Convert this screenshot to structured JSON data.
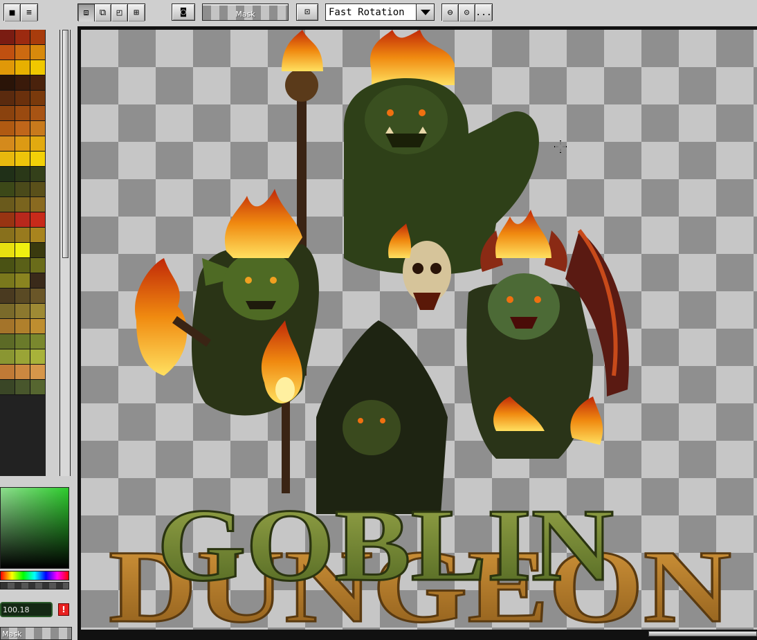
{
  "toolbar": {
    "mask_label": "Mask",
    "mode_value": "Fast Rotation",
    "more_label": "...",
    "buttons": [
      "stop-icon",
      "menu-icon",
      "select-icon",
      "copy-icon",
      "paste-icon",
      "grid-icon",
      "brush-icon",
      "sieve-icon"
    ]
  },
  "sidebar": {
    "zoom_value": "100.18",
    "warning_label": "!",
    "mask_label": "Mask",
    "palette": [
      "#7a1c12",
      "#9c2a10",
      "#a83c0c",
      "#c05010",
      "#cc6a10",
      "#d88a0c",
      "#e09808",
      "#e8b000",
      "#f0c800",
      "#2a1408",
      "#3a1a0a",
      "#4a220c",
      "#5a2a0e",
      "#6a300c",
      "#7a3a0c",
      "#8a420e",
      "#9a4a10",
      "#a85414",
      "#b05a12",
      "#c0661a",
      "#c87a1c",
      "#d48a1c",
      "#dc9a14",
      "#e2aa10",
      "#e8b80e",
      "#eec40a",
      "#f2d008",
      "#203018",
      "#2a3818",
      "#34401a",
      "#3c4818",
      "#4a4a1a",
      "#5a501a",
      "#6a5a1c",
      "#7a641e",
      "#8a6a20",
      "#983412",
      "#b8281c",
      "#c82a1a",
      "#88701c",
      "#987a1e",
      "#a8841e",
      "#e8e010",
      "#f0f010",
      "#3a3a0e",
      "#4a5214",
      "#5a6018",
      "#6a6c1a",
      "#7a781c",
      "#8a8420",
      "#3a2a1a",
      "#4a3a20",
      "#5a4a24",
      "#6a5628",
      "#7a6a2a",
      "#8c782e",
      "#9e8a34",
      "#a4742a",
      "#b0802c",
      "#be8e30",
      "#5c6a26",
      "#6a7a2a",
      "#7a882e",
      "#8a9632",
      "#9aa436",
      "#a8b23a",
      "#c07a36",
      "#cc8840",
      "#d6964a",
      "#3a4626",
      "#48562c",
      "#566630"
    ]
  },
  "canvas": {
    "artwork": {
      "title_line1": "GOBLIN",
      "title_line2": "DUNGEON"
    }
  },
  "colors": {
    "checker_dark": "#8f8f8f",
    "checker_light": "#c6c6c6",
    "title_green": "#6f8a2e",
    "title_gold": "#b87b26"
  }
}
